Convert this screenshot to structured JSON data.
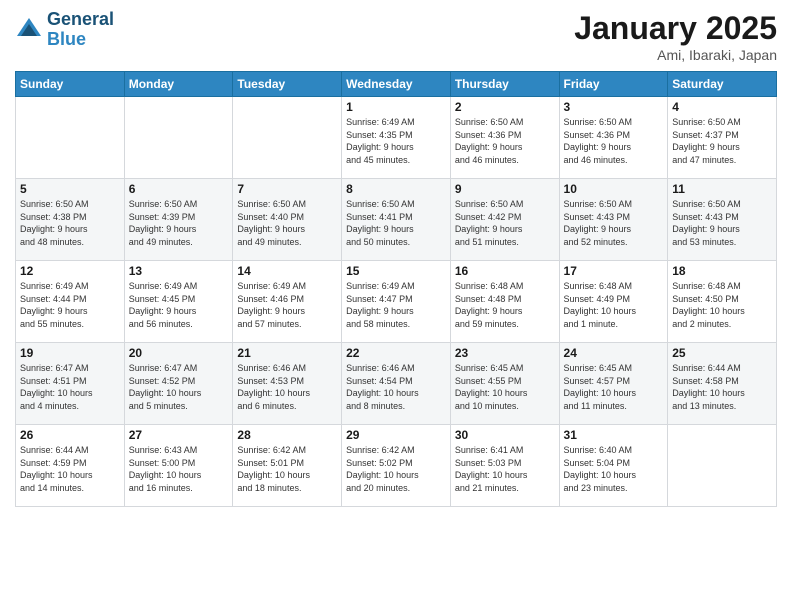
{
  "header": {
    "logo_line1": "General",
    "logo_line2": "Blue",
    "title": "January 2025",
    "subtitle": "Ami, Ibaraki, Japan"
  },
  "weekdays": [
    "Sunday",
    "Monday",
    "Tuesday",
    "Wednesday",
    "Thursday",
    "Friday",
    "Saturday"
  ],
  "weeks": [
    [
      {
        "day": "",
        "info": ""
      },
      {
        "day": "",
        "info": ""
      },
      {
        "day": "",
        "info": ""
      },
      {
        "day": "1",
        "info": "Sunrise: 6:49 AM\nSunset: 4:35 PM\nDaylight: 9 hours\nand 45 minutes."
      },
      {
        "day": "2",
        "info": "Sunrise: 6:50 AM\nSunset: 4:36 PM\nDaylight: 9 hours\nand 46 minutes."
      },
      {
        "day": "3",
        "info": "Sunrise: 6:50 AM\nSunset: 4:36 PM\nDaylight: 9 hours\nand 46 minutes."
      },
      {
        "day": "4",
        "info": "Sunrise: 6:50 AM\nSunset: 4:37 PM\nDaylight: 9 hours\nand 47 minutes."
      }
    ],
    [
      {
        "day": "5",
        "info": "Sunrise: 6:50 AM\nSunset: 4:38 PM\nDaylight: 9 hours\nand 48 minutes."
      },
      {
        "day": "6",
        "info": "Sunrise: 6:50 AM\nSunset: 4:39 PM\nDaylight: 9 hours\nand 49 minutes."
      },
      {
        "day": "7",
        "info": "Sunrise: 6:50 AM\nSunset: 4:40 PM\nDaylight: 9 hours\nand 49 minutes."
      },
      {
        "day": "8",
        "info": "Sunrise: 6:50 AM\nSunset: 4:41 PM\nDaylight: 9 hours\nand 50 minutes."
      },
      {
        "day": "9",
        "info": "Sunrise: 6:50 AM\nSunset: 4:42 PM\nDaylight: 9 hours\nand 51 minutes."
      },
      {
        "day": "10",
        "info": "Sunrise: 6:50 AM\nSunset: 4:43 PM\nDaylight: 9 hours\nand 52 minutes."
      },
      {
        "day": "11",
        "info": "Sunrise: 6:50 AM\nSunset: 4:43 PM\nDaylight: 9 hours\nand 53 minutes."
      }
    ],
    [
      {
        "day": "12",
        "info": "Sunrise: 6:49 AM\nSunset: 4:44 PM\nDaylight: 9 hours\nand 55 minutes."
      },
      {
        "day": "13",
        "info": "Sunrise: 6:49 AM\nSunset: 4:45 PM\nDaylight: 9 hours\nand 56 minutes."
      },
      {
        "day": "14",
        "info": "Sunrise: 6:49 AM\nSunset: 4:46 PM\nDaylight: 9 hours\nand 57 minutes."
      },
      {
        "day": "15",
        "info": "Sunrise: 6:49 AM\nSunset: 4:47 PM\nDaylight: 9 hours\nand 58 minutes."
      },
      {
        "day": "16",
        "info": "Sunrise: 6:48 AM\nSunset: 4:48 PM\nDaylight: 9 hours\nand 59 minutes."
      },
      {
        "day": "17",
        "info": "Sunrise: 6:48 AM\nSunset: 4:49 PM\nDaylight: 10 hours\nand 1 minute."
      },
      {
        "day": "18",
        "info": "Sunrise: 6:48 AM\nSunset: 4:50 PM\nDaylight: 10 hours\nand 2 minutes."
      }
    ],
    [
      {
        "day": "19",
        "info": "Sunrise: 6:47 AM\nSunset: 4:51 PM\nDaylight: 10 hours\nand 4 minutes."
      },
      {
        "day": "20",
        "info": "Sunrise: 6:47 AM\nSunset: 4:52 PM\nDaylight: 10 hours\nand 5 minutes."
      },
      {
        "day": "21",
        "info": "Sunrise: 6:46 AM\nSunset: 4:53 PM\nDaylight: 10 hours\nand 6 minutes."
      },
      {
        "day": "22",
        "info": "Sunrise: 6:46 AM\nSunset: 4:54 PM\nDaylight: 10 hours\nand 8 minutes."
      },
      {
        "day": "23",
        "info": "Sunrise: 6:45 AM\nSunset: 4:55 PM\nDaylight: 10 hours\nand 10 minutes."
      },
      {
        "day": "24",
        "info": "Sunrise: 6:45 AM\nSunset: 4:57 PM\nDaylight: 10 hours\nand 11 minutes."
      },
      {
        "day": "25",
        "info": "Sunrise: 6:44 AM\nSunset: 4:58 PM\nDaylight: 10 hours\nand 13 minutes."
      }
    ],
    [
      {
        "day": "26",
        "info": "Sunrise: 6:44 AM\nSunset: 4:59 PM\nDaylight: 10 hours\nand 14 minutes."
      },
      {
        "day": "27",
        "info": "Sunrise: 6:43 AM\nSunset: 5:00 PM\nDaylight: 10 hours\nand 16 minutes."
      },
      {
        "day": "28",
        "info": "Sunrise: 6:42 AM\nSunset: 5:01 PM\nDaylight: 10 hours\nand 18 minutes."
      },
      {
        "day": "29",
        "info": "Sunrise: 6:42 AM\nSunset: 5:02 PM\nDaylight: 10 hours\nand 20 minutes."
      },
      {
        "day": "30",
        "info": "Sunrise: 6:41 AM\nSunset: 5:03 PM\nDaylight: 10 hours\nand 21 minutes."
      },
      {
        "day": "31",
        "info": "Sunrise: 6:40 AM\nSunset: 5:04 PM\nDaylight: 10 hours\nand 23 minutes."
      },
      {
        "day": "",
        "info": ""
      }
    ]
  ]
}
